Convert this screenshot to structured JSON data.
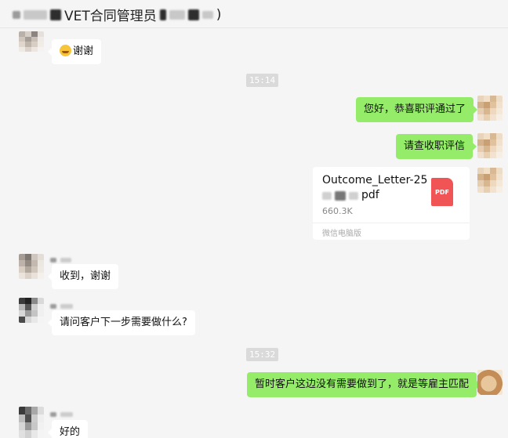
{
  "header": {
    "title_prefix": "",
    "title_main": "VET合同管理员",
    "title_suffix": ")"
  },
  "messages": [
    {
      "id": "m1",
      "dir": "in",
      "text": "谢谢",
      "has_emoji": true
    },
    {
      "id": "t1",
      "type": "time",
      "text": "15:14"
    },
    {
      "id": "m2",
      "dir": "out",
      "text": "您好，恭喜职评通过了"
    },
    {
      "id": "m3",
      "dir": "out",
      "text": "请查收职评信"
    },
    {
      "id": "m4",
      "dir": "out",
      "type": "file",
      "file_name_line1": "Outcome_Letter-25",
      "file_name_line2": "pdf",
      "file_size": "660.3K",
      "file_source": "微信电脑版",
      "file_icon_label": "PDF"
    },
    {
      "id": "m5",
      "dir": "in",
      "text": "收到，谢谢"
    },
    {
      "id": "m6",
      "dir": "in",
      "text": "请问客户下一步需要做什么?"
    },
    {
      "id": "t2",
      "type": "time",
      "text": "15:32"
    },
    {
      "id": "m7",
      "dir": "out",
      "text": "暂时客户这边没有需要做到了，就是等雇主匹配"
    },
    {
      "id": "m8",
      "dir": "in",
      "text": "好的"
    }
  ],
  "colors": {
    "outgoing_bubble": "#95ec69",
    "incoming_bubble": "#ffffff",
    "background": "#f5f5f5",
    "pdf_icon": "#f05454"
  }
}
